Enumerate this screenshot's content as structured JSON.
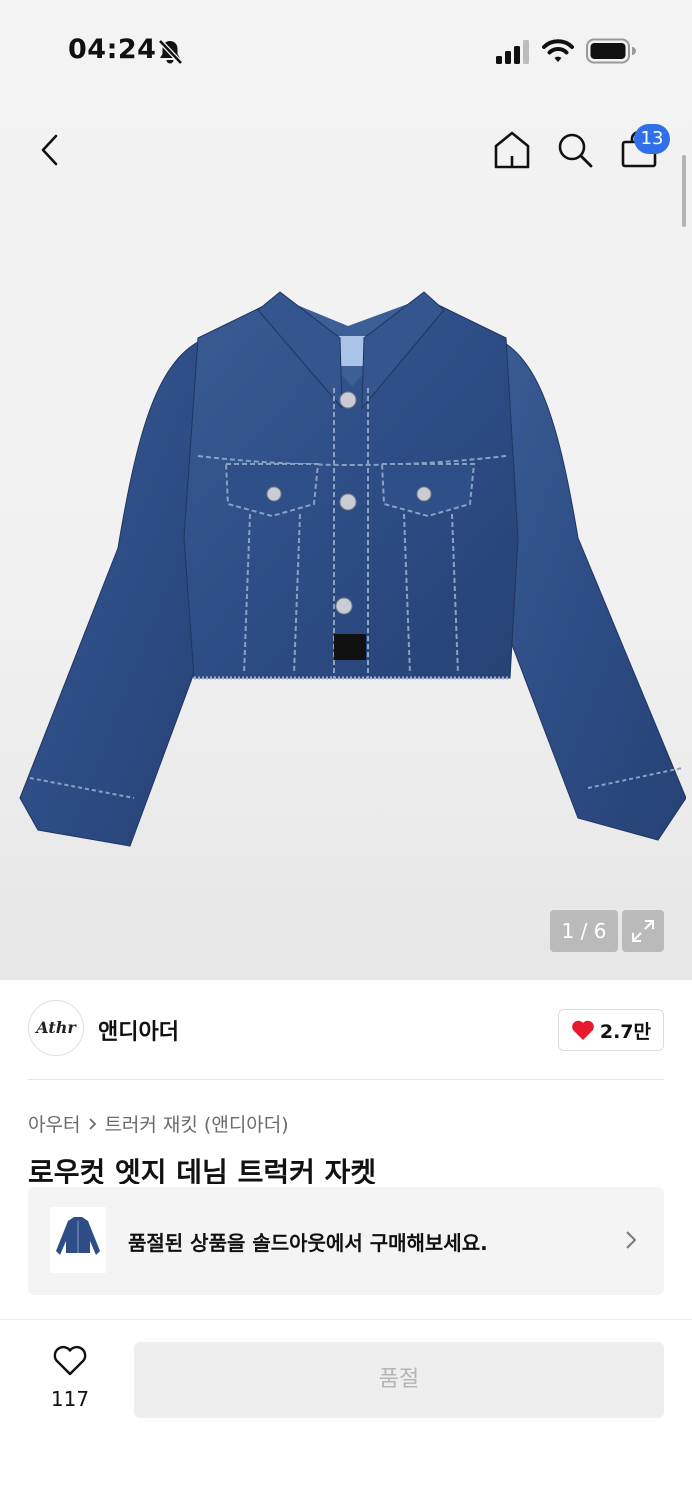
{
  "status_bar": {
    "time": "04:24",
    "icons": [
      "bell-slash-icon",
      "signal-icon",
      "wifi-icon",
      "battery-icon"
    ]
  },
  "nav": {
    "icons": [
      "back-arrow-icon",
      "home-icon",
      "search-icon",
      "shopping-bag-icon"
    ],
    "cart_count": "13",
    "badge_color": "#2f6fe8"
  },
  "gallery": {
    "image": "cropped denim trucker jacket",
    "page_indicator": "1 / 6"
  },
  "brand": {
    "logo_text": "Athr",
    "name": "앤디아더",
    "like_count": "2.7만",
    "heart_color": "#e8192c"
  },
  "breadcrumb": [
    "아우터",
    "트러커 재킷 (앤디아더)"
  ],
  "product": {
    "title": "로우컷 엣지 데님 트럭커 자켓"
  },
  "soldout_banner": {
    "text": "품절된 상품을 솔드아웃에서 구매해보세요."
  },
  "bottom_bar": {
    "wish_count": "117",
    "action_label": "품절"
  }
}
